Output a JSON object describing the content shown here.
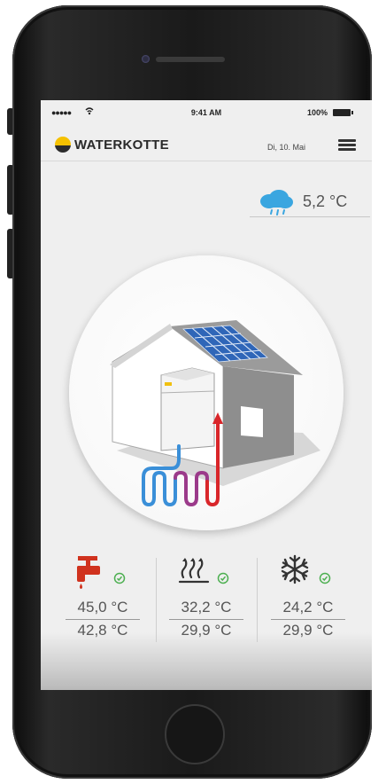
{
  "status_bar": {
    "signal": "●●●●●",
    "wifi_icon": "wifi-icon",
    "time": "9:41 AM",
    "battery_percent": "100%"
  },
  "header": {
    "brand": "WATERKOTTE",
    "date": "Di, 10. Mai",
    "menu_icon": "hamburger-menu-icon",
    "colors": {
      "logo_yellow": "#f5c100",
      "logo_dark": "#2c2c2c"
    }
  },
  "weather": {
    "icon": "cloud-rain-icon",
    "outdoor_temperature": "5,2 °C",
    "icon_color": "#3aa6e0"
  },
  "illustration": {
    "icon": "house-heat-pump-illustration"
  },
  "metrics": [
    {
      "icon": "water-tap-icon",
      "status_icon": "check-circle-icon",
      "value_top": "45,0 °C",
      "value_bottom": "42,8 °C",
      "color": "#d0321e"
    },
    {
      "icon": "heating-icon",
      "status_icon": "check-circle-icon",
      "value_top": "32,2 °C",
      "value_bottom": "29,9 °C",
      "color": "#333333"
    },
    {
      "icon": "snowflake-cooling-icon",
      "status_icon": "check-circle-icon",
      "value_top": "24,2 °C",
      "value_bottom": "29,9 °C",
      "color": "#333333"
    }
  ],
  "status_color": "#4caf50"
}
